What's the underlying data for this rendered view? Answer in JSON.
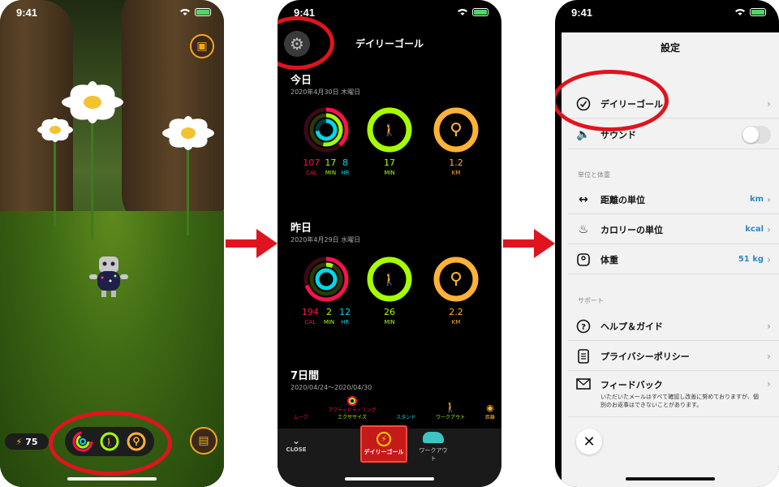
{
  "status": {
    "time": "9:41"
  },
  "phone1": {
    "energy_value": "75"
  },
  "phone2": {
    "header_title": "デイリーゴール",
    "today": {
      "title": "今日",
      "date": "2020年4月30日 木曜日",
      "cal": "107",
      "min": "17",
      "hr": "8",
      "cal_label": "CAL",
      "min_label": "MIN",
      "hr_label": "HR",
      "steps_value": "17",
      "steps_unit": "MIN",
      "dist_value": "1.2",
      "dist_unit": "KM"
    },
    "yesterday": {
      "title": "昨日",
      "date": "2020年4月29日 水曜日",
      "cal": "194",
      "min": "2",
      "hr": "12",
      "cal_label": "CAL",
      "min_label": "MIN",
      "hr_label": "HR",
      "steps_value": "26",
      "steps_unit": "MIN",
      "dist_value": "2.2",
      "dist_unit": "KM"
    },
    "week": {
      "title": "7日間",
      "range": "2020/04/24〜2020/04/30",
      "legend": [
        "ムーブ",
        "アクティビティリング",
        "エクササイズ",
        "スタンド",
        "ワークアウト",
        "距離"
      ]
    },
    "tabbar": {
      "close_label": "CLOSE",
      "daily_label": "デイリーゴール",
      "workout_label": "ワークアウト"
    }
  },
  "phone3": {
    "title": "設定",
    "daily_goal_label": "デイリーゴール",
    "sound_label": "サウンド",
    "units_section": "単位と体重",
    "distance_label": "距離の単位",
    "distance_value": "km",
    "calorie_label": "カロリーの単位",
    "calorie_value": "kcal",
    "weight_label": "体重",
    "weight_value": "51 kg",
    "support_section": "サポート",
    "help_label": "ヘルプ＆ガイド",
    "privacy_label": "プライバシーポリシー",
    "feedback_label": "フィードバック",
    "feedback_note": "いただいたメールはすべて確認し改善に努めておりますが、個別のお返事はできないことがあります。"
  },
  "colors": {
    "move": "#fa114f",
    "exercise": "#a6ff00",
    "stand": "#00d7e8",
    "distance": "#ffb238",
    "highlight": "#e0141e",
    "link": "#2a8ac4"
  }
}
